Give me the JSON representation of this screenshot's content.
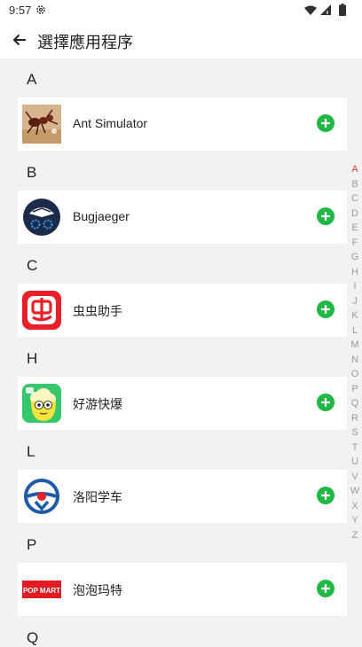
{
  "status_bar": {
    "time": "9:57"
  },
  "header": {
    "title": "選擇應用程序"
  },
  "sections": [
    {
      "letter": "A",
      "app": {
        "name": "Ant Simulator",
        "icon": "ant-simulator-icon"
      }
    },
    {
      "letter": "B",
      "app": {
        "name": "Bugjaeger",
        "icon": "bugjaeger-icon"
      }
    },
    {
      "letter": "C",
      "app": {
        "name": "虫虫助手",
        "icon": "chongchong-icon"
      }
    },
    {
      "letter": "H",
      "app": {
        "name": "好游快爆",
        "icon": "haoyou-icon"
      }
    },
    {
      "letter": "L",
      "app": {
        "name": "洛阳学车",
        "icon": "luoyang-icon"
      }
    },
    {
      "letter": "P",
      "app": {
        "name": "泡泡玛特",
        "icon": "popmart-icon",
        "logo_text": "POP MART"
      }
    },
    {
      "letter": "Q"
    }
  ],
  "index_bar": [
    "A",
    "B",
    "C",
    "D",
    "E",
    "F",
    "G",
    "H",
    "I",
    "J",
    "K",
    "L",
    "M",
    "N",
    "O",
    "P",
    "Q",
    "R",
    "S",
    "T",
    "U",
    "V",
    "W",
    "X",
    "Y",
    "Z"
  ],
  "colors": {
    "add": "#1fb845",
    "index_active": "#e8453c",
    "index": "#9a9a9a",
    "background": "#f2f2f2"
  }
}
